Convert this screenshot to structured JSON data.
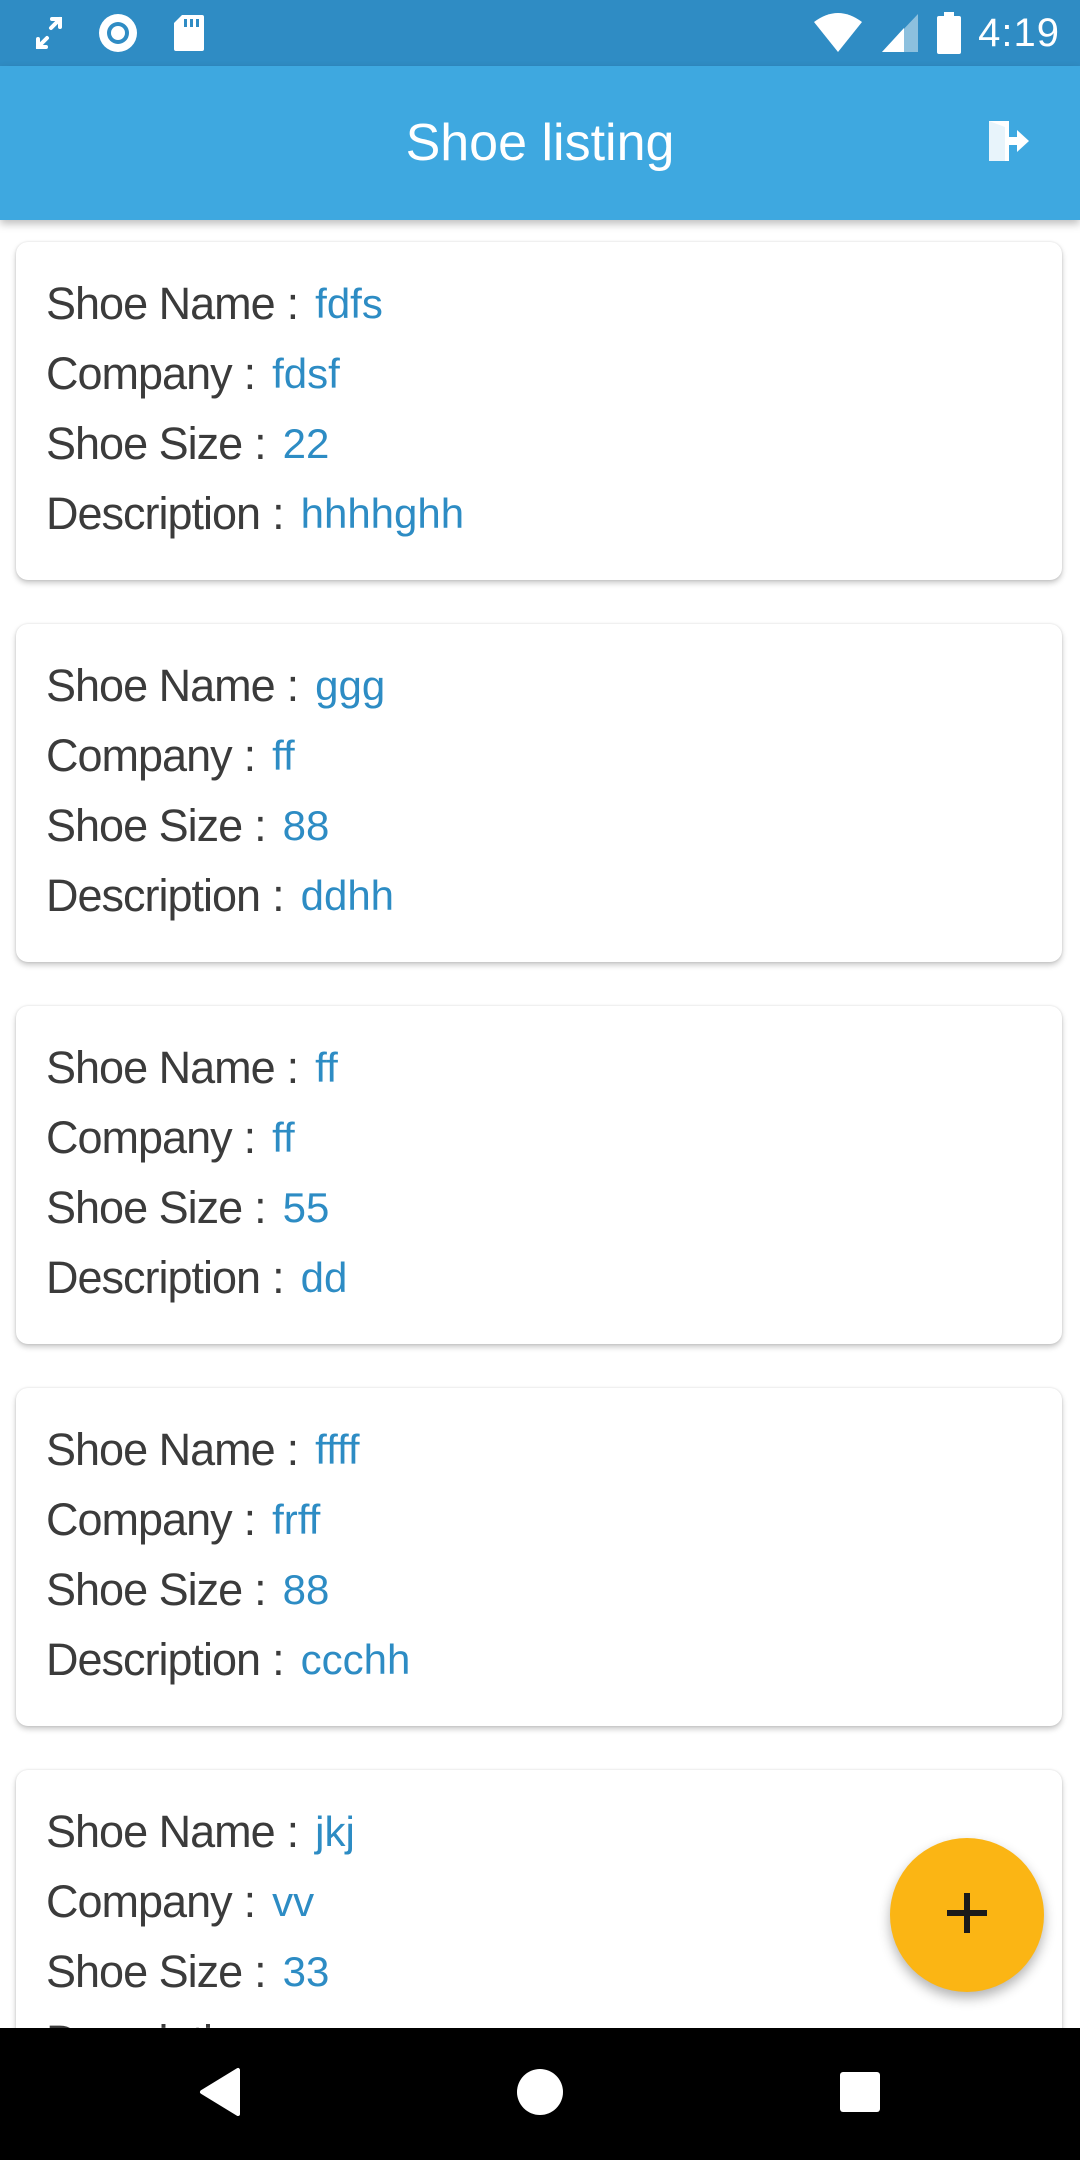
{
  "status_bar": {
    "time": "4:19",
    "left_icons": [
      "expand-icon",
      "record-icon",
      "sd-card-icon"
    ],
    "right_icons": [
      "wifi-icon",
      "signal-icon",
      "battery-icon"
    ]
  },
  "app_bar": {
    "title": "Shoe listing",
    "action_icon": "logout-icon"
  },
  "labels": {
    "name": "Shoe Name",
    "company": "Company",
    "size": "Shoe Size",
    "description": "Description",
    "separator": ":"
  },
  "shoes": [
    {
      "name": "fdfs",
      "company": "fdsf",
      "size": "22",
      "description": "hhhhghh"
    },
    {
      "name": "ggg",
      "company": "ff",
      "size": "88",
      "description": "ddhh"
    },
    {
      "name": "ff",
      "company": "ff",
      "size": "55",
      "description": "dd"
    },
    {
      "name": "ffff",
      "company": "frff",
      "size": "88",
      "description": "ccchh"
    },
    {
      "name": "jkj",
      "company": "vv",
      "size": "33",
      "description": ""
    }
  ],
  "fab": {
    "icon": "plus-icon"
  },
  "nav_bar": {
    "icons": [
      "back-icon",
      "home-icon",
      "recents-icon"
    ]
  },
  "colors": {
    "status_bar": "#2f8cc4",
    "app_bar": "#3ea8e0",
    "value_text": "#2d8cc4",
    "label_text": "#3b3b3b",
    "fab": "#fbb514",
    "nav_bar": "#000000"
  }
}
